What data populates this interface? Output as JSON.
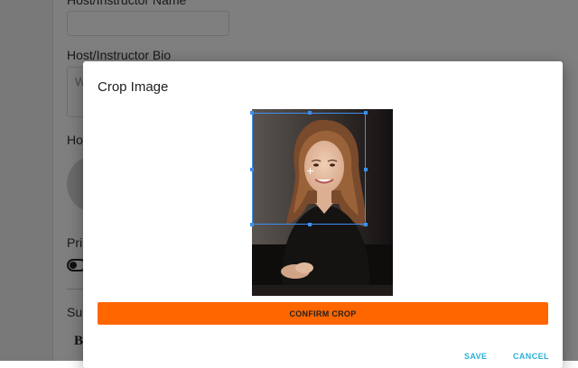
{
  "background_form": {
    "host_name_label": "Host/Instructor Name",
    "host_bio_label": "Host/Instructor Bio",
    "host_bio_placeholder_partial": "W",
    "host_photo_label_partial": "Ho",
    "private_label_partial": "Pri",
    "submit_label_partial": "Su"
  },
  "modal": {
    "title": "Crop Image",
    "confirm_crop_label": "CONFIRM CROP",
    "save_label": "SAVE",
    "cancel_label": "CANCEL"
  },
  "colors": {
    "confirm_button": "#ff6600",
    "action_text": "#2ab0d8",
    "crop_box": "#3d8ff0"
  }
}
